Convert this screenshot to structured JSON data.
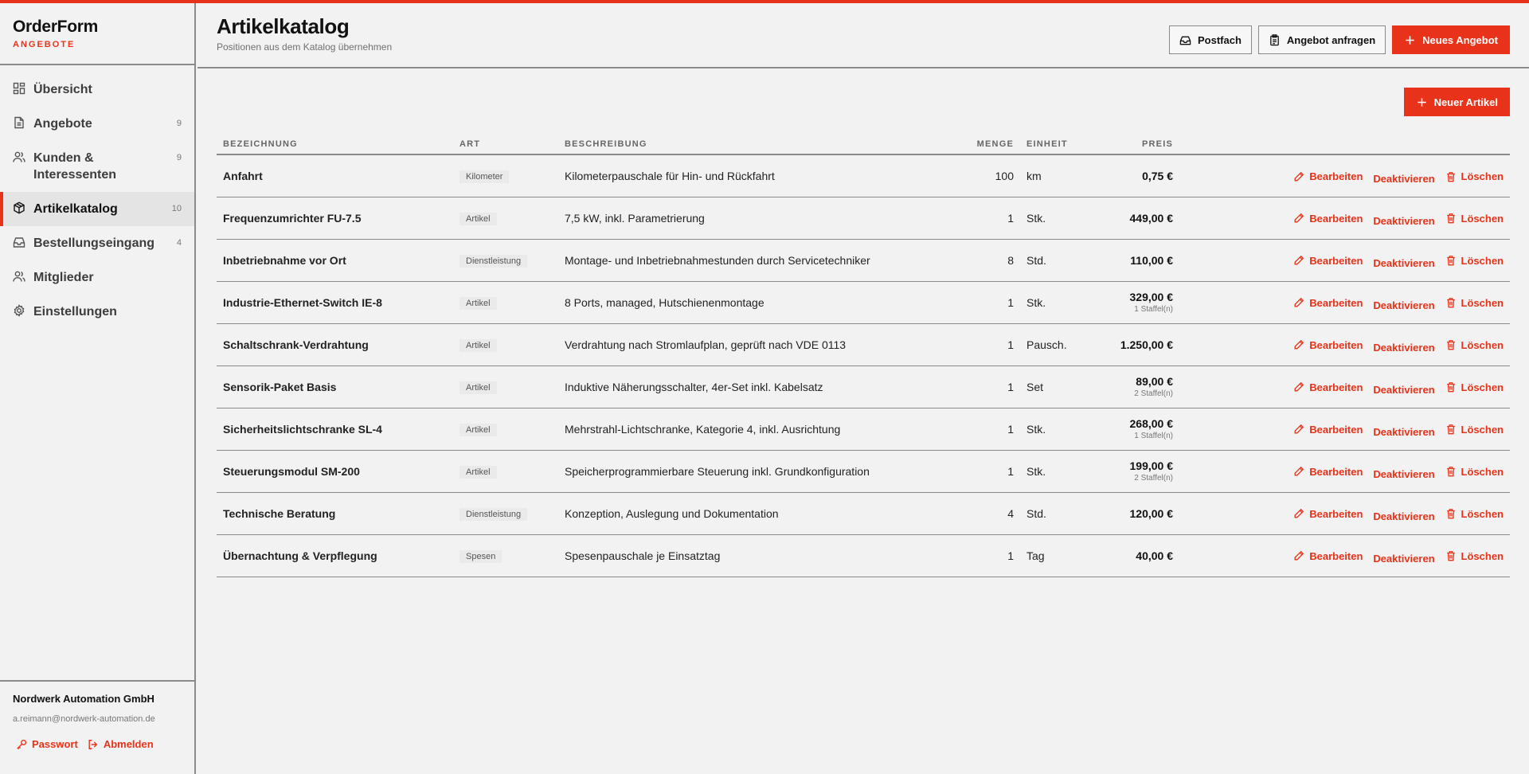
{
  "app": {
    "name": "OrderForm",
    "section": "ANGEBOTE",
    "accent": "#e8331a"
  },
  "sidebar": {
    "items": [
      {
        "label": "Übersicht",
        "count": "",
        "icon": "dashboard-icon",
        "active": false
      },
      {
        "label": "Angebote",
        "count": "9",
        "icon": "document-icon",
        "active": false
      },
      {
        "label": "Kunden & Interessenten",
        "count": "9",
        "icon": "users-icon",
        "active": false
      },
      {
        "label": "Artikelkatalog",
        "count": "10",
        "icon": "package-icon",
        "active": true
      },
      {
        "label": "Bestellungseingang",
        "count": "4",
        "icon": "inbox-icon",
        "active": false
      },
      {
        "label": "Mitglieder",
        "count": "",
        "icon": "members-icon",
        "active": false
      },
      {
        "label": "Einstellungen",
        "count": "",
        "icon": "gear-icon",
        "active": false
      }
    ],
    "footer": {
      "org": "Nordwerk Automation GmbH",
      "email": "a.reimann@nordwerk-automation.de",
      "password_label": "Passwort",
      "logout_label": "Abmelden"
    }
  },
  "header": {
    "title": "Artikelkatalog",
    "subtitle": "Positionen aus dem Katalog übernehmen",
    "inbox_label": "Postfach",
    "request_label": "Angebot anfragen",
    "new_offer_label": "Neues Angebot"
  },
  "main": {
    "new_item_label": "Neuer Artikel",
    "columns": {
      "name": "BEZEICHNUNG",
      "type": "ART",
      "description": "BESCHREIBUNG",
      "qty": "MENGE",
      "unit": "EINHEIT",
      "price": "PREIS"
    },
    "actions": {
      "edit": "Bearbeiten",
      "deactivate": "Deaktivieren",
      "delete": "Löschen"
    },
    "rows": [
      {
        "name": "Anfahrt",
        "type": "Kilometer",
        "description": "Kilometerpauschale für Hin- und Rückfahrt",
        "qty": "100",
        "unit": "km",
        "price": "0,75 €",
        "tier": ""
      },
      {
        "name": "Frequenzumrichter FU-7.5",
        "type": "Artikel",
        "description": "7,5 kW, inkl. Parametrierung",
        "qty": "1",
        "unit": "Stk.",
        "price": "449,00 €",
        "tier": ""
      },
      {
        "name": "Inbetriebnahme vor Ort",
        "type": "Dienstleistung",
        "description": "Montage- und Inbetriebnahmestunden durch Servicetechniker",
        "qty": "8",
        "unit": "Std.",
        "price": "110,00 €",
        "tier": ""
      },
      {
        "name": "Industrie-Ethernet-Switch IE-8",
        "type": "Artikel",
        "description": "8 Ports, managed, Hutschienenmontage",
        "qty": "1",
        "unit": "Stk.",
        "price": "329,00 €",
        "tier": "1 Staffel(n)"
      },
      {
        "name": "Schaltschrank-Verdrahtung",
        "type": "Artikel",
        "description": "Verdrahtung nach Stromlaufplan, geprüft nach VDE 0113",
        "qty": "1",
        "unit": "Pausch.",
        "price": "1.250,00 €",
        "tier": ""
      },
      {
        "name": "Sensorik-Paket Basis",
        "type": "Artikel",
        "description": "Induktive Näherungsschalter, 4er-Set inkl. Kabelsatz",
        "qty": "1",
        "unit": "Set",
        "price": "89,00 €",
        "tier": "2 Staffel(n)"
      },
      {
        "name": "Sicherheitslichtschranke SL-4",
        "type": "Artikel",
        "description": "Mehrstrahl-Lichtschranke, Kategorie 4, inkl. Ausrichtung",
        "qty": "1",
        "unit": "Stk.",
        "price": "268,00 €",
        "tier": "1 Staffel(n)"
      },
      {
        "name": "Steuerungsmodul SM-200",
        "type": "Artikel",
        "description": "Speicherprogrammierbare Steuerung inkl. Grundkonfiguration",
        "qty": "1",
        "unit": "Stk.",
        "price": "199,00 €",
        "tier": "2 Staffel(n)"
      },
      {
        "name": "Technische Beratung",
        "type": "Dienstleistung",
        "description": "Konzeption, Auslegung und Dokumentation",
        "qty": "4",
        "unit": "Std.",
        "price": "120,00 €",
        "tier": ""
      },
      {
        "name": "Übernachtung & Verpflegung",
        "type": "Spesen",
        "description": "Spesenpauschale je Einsatztag",
        "qty": "1",
        "unit": "Tag",
        "price": "40,00 €",
        "tier": ""
      }
    ]
  }
}
